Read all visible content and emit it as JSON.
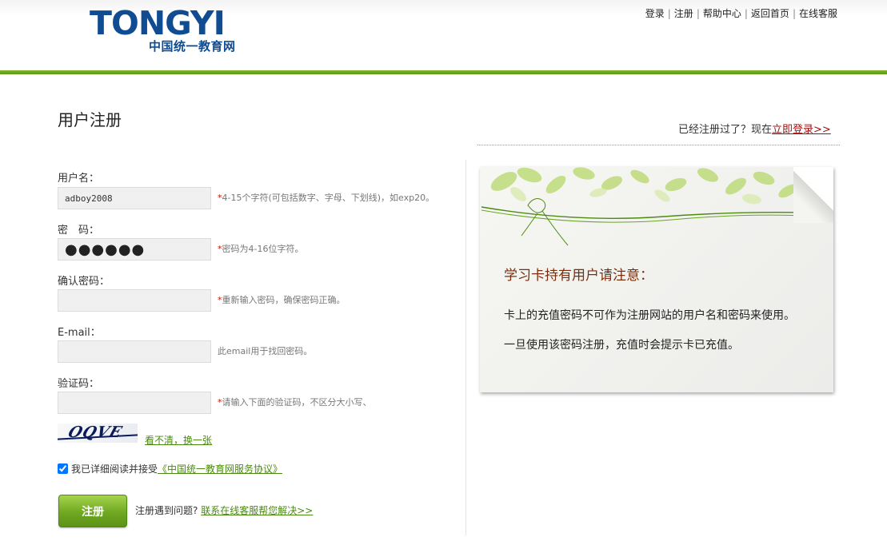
{
  "header": {
    "logo_word": "TONGYI",
    "logo_sub": "中国统一教育网",
    "nav": [
      {
        "label": "登录"
      },
      {
        "label": "注册"
      },
      {
        "label": "帮助中心"
      },
      {
        "label": "返回首页"
      },
      {
        "label": "在线客服"
      }
    ]
  },
  "page": {
    "title": "用户注册",
    "login_prompt": "已经注册过了？现在",
    "login_link": "立即登录>>"
  },
  "form": {
    "username": {
      "label": "用户名：",
      "value": "adboy2008",
      "star": "*",
      "hint": "4-15个字符(可包括数字、字母、下划线)，如exp20。"
    },
    "password": {
      "label": "密　码：",
      "value": "●●●●●●",
      "star": "*",
      "hint": "密码为4-16位字符。"
    },
    "confirm": {
      "label": "确认密码：",
      "value": "",
      "star": "*",
      "hint": "重新输入密码，确保密码正确。"
    },
    "email": {
      "label": "E-mail：",
      "value": "",
      "hint": "此email用于找回密码。"
    },
    "captcha": {
      "label": "验证码：",
      "value": "",
      "star": "*",
      "hint": "请输入下面的验证码，不区分大小写、",
      "image_text": "OQVE",
      "refresh_label": "看不清，换一张"
    },
    "agree": {
      "checked": true,
      "text": "我已详细阅读并接受",
      "link": "《中国统一教育网服务协议》"
    },
    "submit_label": "注册",
    "help_text": "注册遇到问题?",
    "help_link": "联系在线客服帮您解决>>"
  },
  "notice": {
    "title": "学习卡持有用户请注意：",
    "lines": [
      "卡上的充值密码不可作为注册网站的用户名和密码来使用。",
      "一旦使用该密码注册，充值时会提示卡已充值。"
    ]
  },
  "colors": {
    "brand_blue": "#0f4c91",
    "green_bar": "#6fa821",
    "login_link": "#a01010",
    "link_green": "#4a8a10",
    "required_star": "#c81010",
    "notice_title": "#7a2e0e"
  }
}
